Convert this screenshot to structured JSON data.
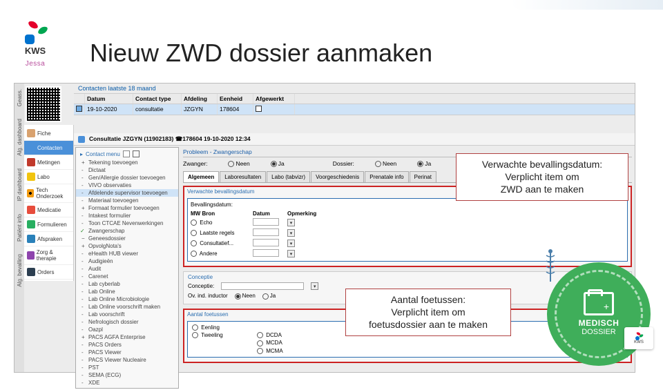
{
  "page": {
    "title": "Nieuw ZWD dossier aanmaken",
    "logo_text": "KWS",
    "logo_sub": "Jessa"
  },
  "side_labels": [
    "Geass.",
    "Alg. dashboard",
    "IP dashboard",
    "Patiënt info",
    "Alg. bevalling"
  ],
  "nav": [
    {
      "label": "Fiche"
    },
    {
      "label": "Contacten",
      "active": true
    },
    {
      "label": "Metingen"
    },
    {
      "label": "Labo"
    },
    {
      "label": "Tech Onderzoek"
    },
    {
      "label": "Medicatie"
    },
    {
      "label": "Formulieren"
    },
    {
      "label": "Afspraken"
    },
    {
      "label": "Zorg & therapie"
    },
    {
      "label": "Orders"
    }
  ],
  "contacts": {
    "header": "Contacten laatste 18 maand",
    "cols": [
      "",
      "Datum",
      "Contact type",
      "Afdeling",
      "Eenheid",
      "Afgewerkt"
    ],
    "row": [
      "",
      "19-10-2020",
      "consultatie",
      "JZGYN",
      "178604",
      ""
    ]
  },
  "detail_bar": "Consultatie JZGYN (11902183) ☎178604 19-10-2020 12:34",
  "context_menu": {
    "title": "Contact menu",
    "items": [
      {
        "t": "Tekening toevoegen",
        "k": "plus"
      },
      {
        "t": "Dictaat",
        "k": "dot"
      },
      {
        "t": "Gen/Allergie dossier toevoegen",
        "k": "dot"
      },
      {
        "t": "VIVO observaties",
        "k": "dot"
      },
      {
        "t": "Afdelende supervisor toevoegen",
        "k": "dot",
        "hl": true
      },
      {
        "t": "Materiaal toevoegen",
        "k": "dot"
      },
      {
        "t": "Formaat formulier toevoegen",
        "k": "plus"
      },
      {
        "t": "Intakest formulier",
        "k": "dot"
      },
      {
        "t": "Toon CTCAE Nevenwerkingen",
        "k": "dot"
      },
      {
        "t": "Zwangerschap",
        "k": "check"
      },
      {
        "t": "Geneesdossier",
        "k": "minus"
      },
      {
        "t": "OpvolgNota's",
        "k": "plus"
      },
      {
        "t": "eHealth HUB viewer",
        "k": "dot"
      },
      {
        "t": "Audigieën",
        "k": "dot"
      },
      {
        "t": "Audit",
        "k": "dot"
      },
      {
        "t": "Carenet",
        "k": "dot"
      },
      {
        "t": "Lab cyberlab",
        "k": "dot"
      },
      {
        "t": "Lab Online",
        "k": "dot"
      },
      {
        "t": "Lab Online Microbiologie",
        "k": "dot"
      },
      {
        "t": "Lab Online voorschrift maken",
        "k": "dot"
      },
      {
        "t": "Lab voorschrift",
        "k": "dot"
      },
      {
        "t": "Nefrologisch dossier",
        "k": "dot"
      },
      {
        "t": "Oazpl",
        "k": "dot"
      },
      {
        "t": "PACS AGFA Enterprise",
        "k": "plus"
      },
      {
        "t": "PACS Orders",
        "k": "dot"
      },
      {
        "t": "PACS Viewer",
        "k": "dot"
      },
      {
        "t": "PACS Viewer Nucleaire",
        "k": "dot"
      },
      {
        "t": "PST",
        "k": "dot"
      },
      {
        "t": "SEMA (ECG)",
        "k": "dot"
      },
      {
        "t": "XDE",
        "k": "dot"
      }
    ]
  },
  "right": {
    "problem": "Probleem - Zwangerschap",
    "zw_label": "Zwanger:",
    "zw_nee": "Neen",
    "zw_ja": "Ja",
    "dossier_label": "Dossier:",
    "dossier_nee": "Neen",
    "dossier_ja": "Ja",
    "tabs": [
      "Algemeen",
      "Laboresultaten",
      "Labo (tabvizr)",
      "Voorgeschiedenis",
      "Prenatale info",
      "Perinat"
    ],
    "sec1_title": "Verwachte bevallingsdatum",
    "sec1_sub": "Bevallingsdatum:",
    "col_mw": "MW Bron",
    "col_dat": "Datum",
    "col_opm": "Opmerking",
    "rows1": [
      "Echo",
      "Laatste regels",
      "Consultatief...",
      "Andere"
    ],
    "conc_title": "Conceptie",
    "conc_label": "Conceptie:",
    "conc_ind": "Ov. ind. inductor",
    "conc_nee": "Neen",
    "conc_ja": "Ja",
    "sec2_title": "Aantal foetussen",
    "foetus_opts": [
      "Eenling",
      "Tweeling"
    ],
    "foetus_sub": [
      "DCDA",
      "MCDA",
      "MCMA"
    ]
  },
  "callouts": {
    "c1_l1": "Verwachte bevallingsdatum:",
    "c1_l2": "Verplicht item om",
    "c1_l3": "ZWD aan te maken",
    "c2_l1": "Aantal foetussen:",
    "c2_l2": "Verplicht item om",
    "c2_l3": "foetusdossier aan te maken"
  },
  "badge": {
    "line1": "MEDISCH",
    "line2": "DOSSIER",
    "card": "KWS"
  }
}
